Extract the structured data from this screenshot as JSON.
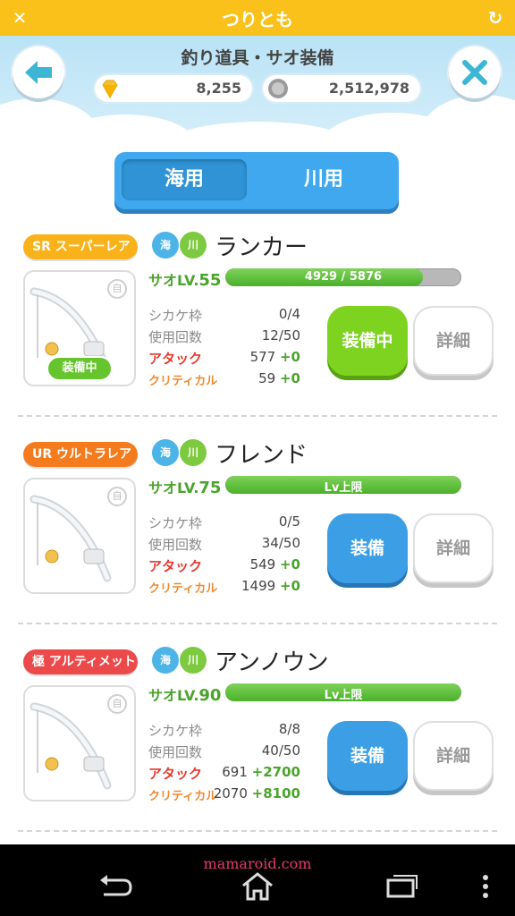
{
  "titlebar": {
    "title": "つりとも",
    "close_icon": "x-icon",
    "refresh_icon": "refresh-icon"
  },
  "header": {
    "screen_title": "釣り道具・サオ装備",
    "gems": "8,255",
    "coins": "2,512,978"
  },
  "tabs": [
    {
      "label": "海用",
      "active": true
    },
    {
      "label": "川用",
      "active": false
    }
  ],
  "lv_prefix": "サオLV.",
  "stat_labels": {
    "slots": "シカケ枠",
    "uses": "使用回数",
    "attack": "アタック",
    "critical": "クリティカル"
  },
  "detail_label": "詳細",
  "sea_badge": "海",
  "river_badge": "川",
  "lock_glyph": "自",
  "rods": [
    {
      "rarity": "SR スーパーレア",
      "rarity_color": "#f9b21a",
      "name": "ランカー",
      "level": "55",
      "bar_text": "4929 / 5876",
      "bar_fraction": 0.8389,
      "slots": "0/4",
      "uses": "12/50",
      "attack": "577",
      "attack_bonus": "+0",
      "critical": "59",
      "critical_bonus": "+0",
      "equip_label": "装備中",
      "equip_state": "equipped",
      "equipped_tag": "装備中"
    },
    {
      "rarity": "UR ウルトラレア",
      "rarity_color": "#f47c1e",
      "name": "フレンド",
      "level": "75",
      "bar_text": "Lv上限",
      "bar_fraction": 1,
      "slots": "0/5",
      "uses": "34/50",
      "attack": "549",
      "attack_bonus": "+0",
      "critical": "1499",
      "critical_bonus": "+0",
      "equip_label": "装備",
      "equip_state": "available",
      "equipped_tag": ""
    },
    {
      "rarity": "極 アルティメット",
      "rarity_color": "#ec4a4a",
      "name": "アンノウン",
      "level": "90",
      "bar_text": "Lv上限",
      "bar_fraction": 1,
      "slots": "8/8",
      "uses": "40/50",
      "attack": "691",
      "attack_bonus": "+2700",
      "critical": "2070",
      "critical_bonus": "+8100",
      "equip_label": "装備",
      "equip_state": "available",
      "equipped_tag": ""
    }
  ],
  "navbar": {
    "watermark": "mamaroid.com",
    "icons": [
      "back-icon",
      "home-icon",
      "recent-apps-icon",
      "menu-dots-icon"
    ]
  }
}
